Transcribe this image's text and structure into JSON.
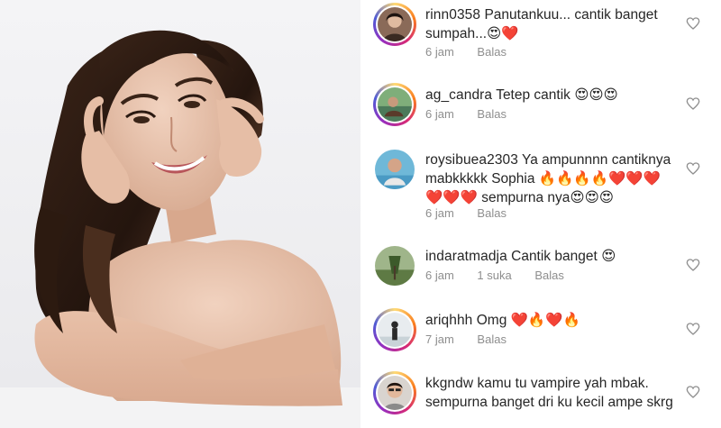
{
  "comments": [
    {
      "username": "rinn0358",
      "text": "Panutankuu... cantik banget sumpah...😍❤️",
      "time": "6 jam",
      "likes": "",
      "reply": "Balas"
    },
    {
      "username": "ag_candra",
      "text": "Tetep cantik 😍😍😍",
      "time": "6 jam",
      "likes": "",
      "reply": "Balas"
    },
    {
      "username": "roysibuea2303",
      "text": "Ya ampunnnn cantiknya mabkkkkk Sophia 🔥🔥🔥🔥❤️❤️❤️❤️❤️❤️ sempurna nya😍😍😍",
      "time": "6 jam",
      "likes": "",
      "reply": "Balas"
    },
    {
      "username": "indaratmadja",
      "text": "Cantik banget 😍",
      "time": "6 jam",
      "likes": "1 suka",
      "reply": "Balas"
    },
    {
      "username": "ariqhhh",
      "text": "Omg ❤️🔥❤️🔥",
      "time": "7 jam",
      "likes": "",
      "reply": "Balas"
    },
    {
      "username": "kkgndw",
      "text": "kamu tu vampire yah mbak. sempurna banget dri ku kecil ampe skrg",
      "time": "",
      "likes": "",
      "reply": ""
    }
  ],
  "icons": {
    "like": "heart-outline-icon",
    "story_ring": "instagram-story-ring"
  },
  "colors": {
    "text": "#262626",
    "meta": "#8e8e8e",
    "heart": "#8e8e8e"
  }
}
